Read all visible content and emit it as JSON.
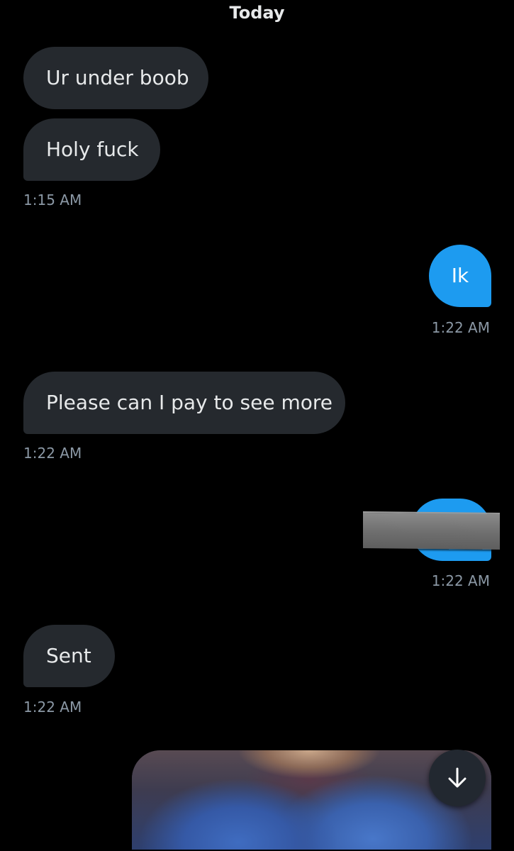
{
  "conversation": {
    "day_header": "Today",
    "messages": [
      {
        "direction": "incoming",
        "text": "Ur under boob"
      },
      {
        "direction": "incoming",
        "text": "Holy fuck",
        "timestamp": "1:15 AM"
      },
      {
        "direction": "outgoing",
        "text": "Ik",
        "timestamp": "1:22 AM"
      },
      {
        "direction": "incoming",
        "text": "Please can I pay to see more",
        "timestamp": "1:22 AM"
      },
      {
        "direction": "outgoing",
        "text": "",
        "redacted": true,
        "timestamp": "1:22 AM"
      },
      {
        "direction": "incoming",
        "text": "Sent",
        "timestamp": "1:22 AM"
      },
      {
        "direction": "outgoing",
        "type": "image",
        "partially_visible": true
      }
    ]
  },
  "controls": {
    "scroll_down_icon": "arrow-down-icon"
  },
  "colors": {
    "background": "#000000",
    "incoming_bubble": "#25292e",
    "outgoing_bubble": "#1d9bf0",
    "timestamp": "#8b98a5",
    "text": "#e7e9ea"
  }
}
